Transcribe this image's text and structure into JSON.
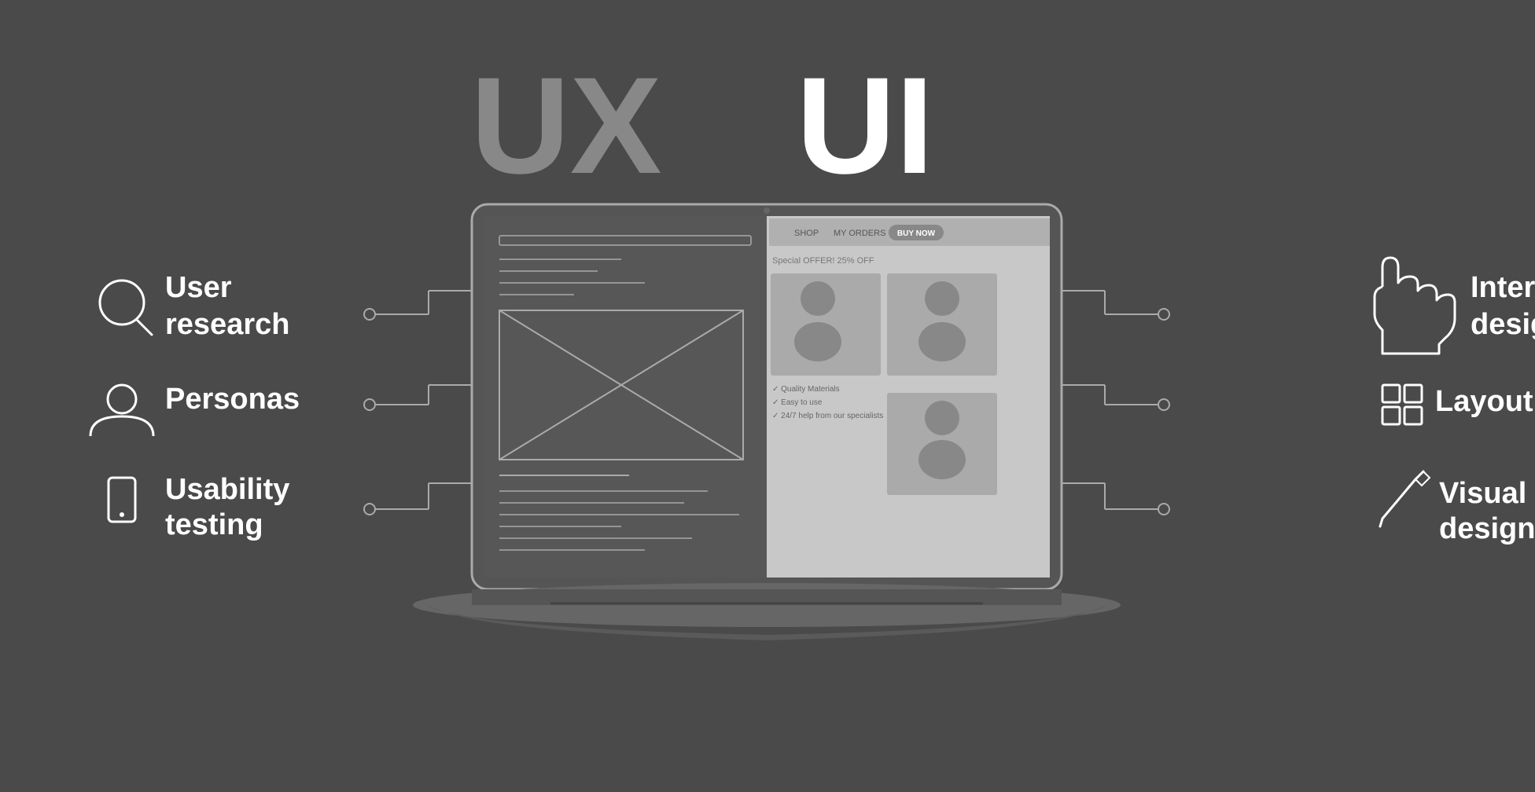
{
  "title": {
    "ux": "UX",
    "ui": "UI"
  },
  "left_items": [
    {
      "id": "user-research",
      "label": "User\nresearch",
      "icon": "search"
    },
    {
      "id": "personas",
      "label": "Personas",
      "icon": "person"
    },
    {
      "id": "usability-testing",
      "label": "Usability\ntesting",
      "icon": "mobile"
    }
  ],
  "right_items": [
    {
      "id": "interaction-design",
      "label": "Interaction\ndesign",
      "icon": "pointer"
    },
    {
      "id": "layout",
      "label": "Layout",
      "icon": "grid"
    },
    {
      "id": "visual-design",
      "label": "Visual\ndesign",
      "icon": "pen"
    }
  ],
  "colors": {
    "background": "#4a4a4a",
    "ux_color": "#888888",
    "ui_color": "#ffffff",
    "text_color": "#ffffff",
    "icon_color": "#ffffff",
    "line_color": "#aaaaaa",
    "dot_color": "#aaaaaa"
  }
}
